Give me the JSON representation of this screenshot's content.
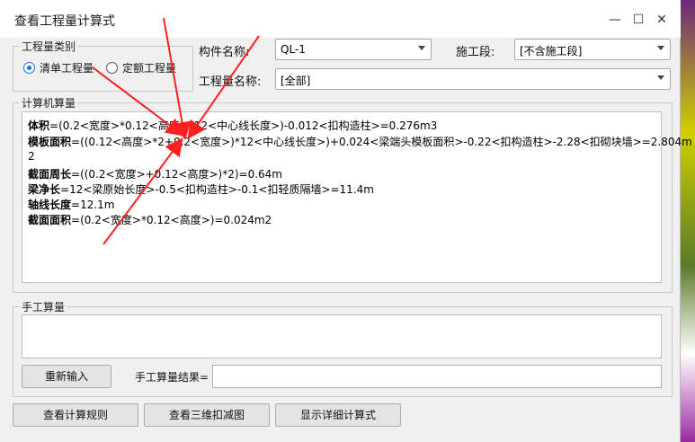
{
  "window": {
    "title": "查看工程量计算式",
    "minimize": "—",
    "maximize": "☐",
    "close": "✕"
  },
  "quantity_type": {
    "group_label": "工程量类别",
    "options": [
      "清单工程量",
      "定额工程量"
    ],
    "selected": "清单工程量"
  },
  "component": {
    "name_label": "构件名称:",
    "name_value": "QL-1",
    "stage_label": "施工段:",
    "stage_value": "[不含施工段]",
    "quantity_name_label": "工程量名称:",
    "quantity_name_value": "[全部]"
  },
  "computer_calc": {
    "group_label": "计算机算量",
    "lines": [
      {
        "key": "体积",
        "expr": "=(0.2<宽度>*0.12<高度>*12<中心线长度>)-0.012<扣构造柱>=0.276m3"
      },
      {
        "key": "模板面积",
        "expr": "=((0.12<高度>*2+0.2<宽度>)*12<中心线长度>)+0.024<梁端头模板面积>-0.22<扣构造柱>-2.28<扣砌块墙>=2.804m"
      },
      {
        "key": "",
        "expr": "2"
      },
      {
        "key": "截面周长",
        "expr": "=((0.2<宽度>+0.12<高度>)*2)=0.64m"
      },
      {
        "key": "梁净长",
        "expr": "=12<梁原始长度>-0.5<扣构造柱>-0.1<扣轻质隔墙>=11.4m"
      },
      {
        "key": "轴线长度",
        "expr": "=12.1m"
      },
      {
        "key": "截面面积",
        "expr": "=(0.2<宽度>*0.12<高度>)=0.024m2"
      }
    ]
  },
  "manual_calc": {
    "group_label": "手工算量",
    "reenter_button": "重新输入",
    "result_label": "手工算量结果=",
    "result_value": ""
  },
  "footer": {
    "view_rules": "查看计算规则",
    "view_3d": "查看三维扣减图",
    "show_detail": "显示详细计算式"
  },
  "annotation": {
    "arrow_color": "#ff2020"
  }
}
